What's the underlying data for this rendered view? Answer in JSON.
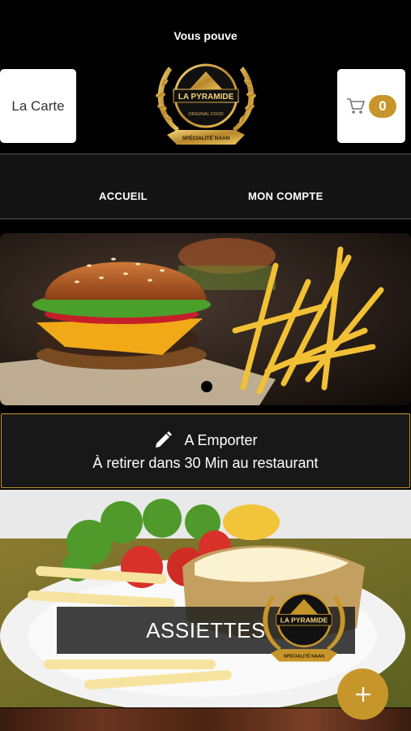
{
  "ticker": "Vous pouve",
  "header": {
    "carte_label": "La Carte",
    "cart_count": "0",
    "logo": {
      "name": "LA PYRAMIDE",
      "tagline": "ORIGINAL FOOD",
      "ribbon": "SPÉCIALITÉ NAAN"
    }
  },
  "nav": {
    "items": [
      "ACCUEIL",
      "MON COMPTE"
    ]
  },
  "info": {
    "line1": "A Emporter",
    "line2": "À retirer dans 30 Min au restaurant"
  },
  "category": {
    "label": "ASSIETTES"
  },
  "colors": {
    "accent": "#c7962a",
    "background": "#000000",
    "nav_bg": "#141414"
  },
  "icons": {
    "cart": "cart-icon",
    "edit": "pencil-icon",
    "add": "plus-icon"
  }
}
